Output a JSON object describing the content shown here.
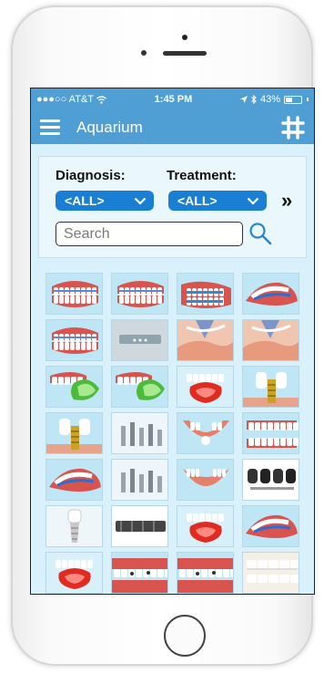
{
  "status_bar": {
    "carrier": "●●●○○ AT&T",
    "time": "1:45 PM",
    "battery": "43%",
    "battery_level": 0.43
  },
  "nav": {
    "title": "Aquarium",
    "menu_icon": "hamburger-icon",
    "grid_icon": "hash-grid-icon"
  },
  "filters": {
    "diagnosis_label": "Diagnosis:",
    "diagnosis_value": "<ALL>",
    "treatment_label": "Treatment:",
    "treatment_value": "<ALL>",
    "more_label": "»"
  },
  "search": {
    "placeholder": "Search",
    "value": ""
  },
  "colors": {
    "bar": "#4f9fd4",
    "dropdown": "#1a7ed2",
    "background": "#d9f1fa"
  },
  "thumbnails": [
    {
      "kind": "braces"
    },
    {
      "kind": "braces"
    },
    {
      "kind": "braces-side"
    },
    {
      "kind": "jaw-blue"
    },
    {
      "kind": "braces"
    },
    {
      "kind": "plain-gray"
    },
    {
      "kind": "tissue"
    },
    {
      "kind": "tissue"
    },
    {
      "kind": "retainer-green"
    },
    {
      "kind": "retainer-green"
    },
    {
      "kind": "retainer-red"
    },
    {
      "kind": "implant-gold"
    },
    {
      "kind": "implant-gold"
    },
    {
      "kind": "implant-screws"
    },
    {
      "kind": "arch-open"
    },
    {
      "kind": "teeth-front"
    },
    {
      "kind": "jaw-blue"
    },
    {
      "kind": "implant-screws"
    },
    {
      "kind": "arch-red"
    },
    {
      "kind": "crowns-dark"
    },
    {
      "kind": "implant-white"
    },
    {
      "kind": "bar-dark"
    },
    {
      "kind": "retainer-red"
    },
    {
      "kind": "jaw-blue"
    },
    {
      "kind": "retainer-red"
    },
    {
      "kind": "teeth-decay"
    },
    {
      "kind": "teeth-decay"
    },
    {
      "kind": "teeth-white"
    }
  ]
}
